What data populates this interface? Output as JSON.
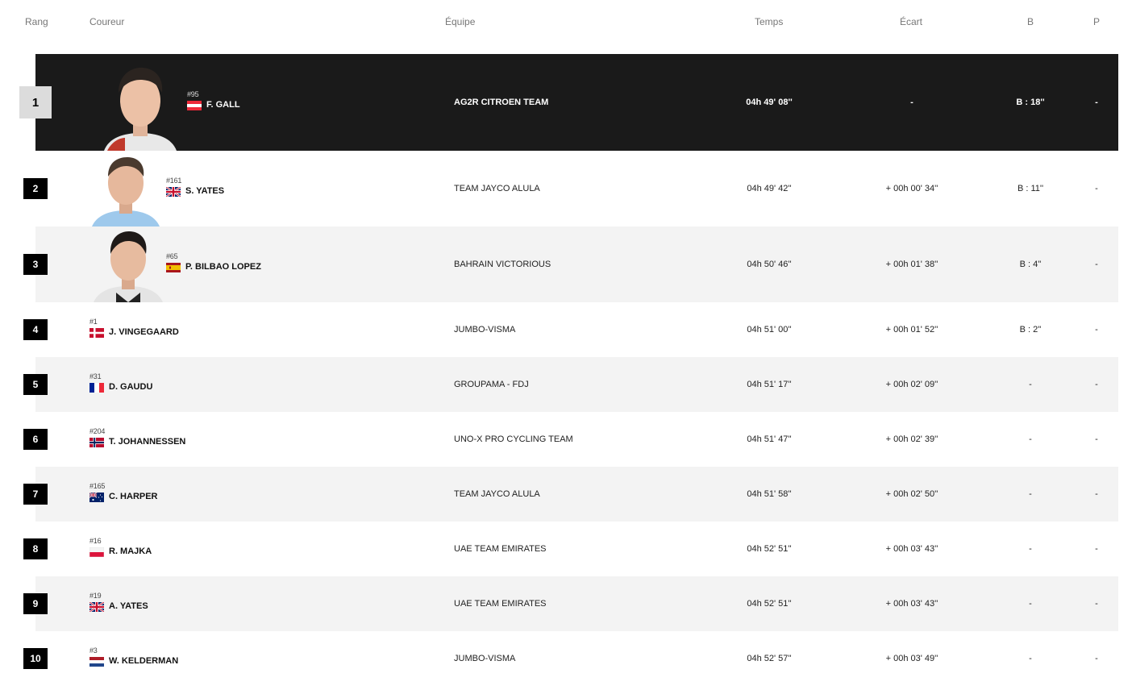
{
  "header": {
    "rang": "Rang",
    "coureur": "Coureur",
    "equipe": "Équipe",
    "temps": "Temps",
    "ecart": "Écart",
    "b": "B",
    "p": "P"
  },
  "rows": [
    {
      "rank": "1",
      "bib": "#95",
      "name": "F. GALL",
      "flag": "austria-flag-icon",
      "team": "AG2R CITROEN TEAM",
      "time": "04h 49' 08''",
      "gap": "-",
      "bonus": "B : 18''",
      "penalty": "-"
    },
    {
      "rank": "2",
      "bib": "#161",
      "name": "S. YATES",
      "flag": "uk-flag-icon",
      "team": "TEAM JAYCO ALULA",
      "time": "04h 49' 42''",
      "gap": "+ 00h 00' 34''",
      "bonus": "B : 11''",
      "penalty": "-"
    },
    {
      "rank": "3",
      "bib": "#65",
      "name": "P. BILBAO LOPEZ",
      "flag": "spain-flag-icon",
      "team": "BAHRAIN VICTORIOUS",
      "time": "04h 50' 46''",
      "gap": "+ 00h 01' 38''",
      "bonus": "B : 4''",
      "penalty": "-"
    },
    {
      "rank": "4",
      "bib": "#1",
      "name": "J. VINGEGAARD",
      "flag": "denmark-flag-icon",
      "team": "JUMBO-VISMA",
      "time": "04h 51' 00''",
      "gap": "+ 00h 01' 52''",
      "bonus": "B : 2''",
      "penalty": "-"
    },
    {
      "rank": "5",
      "bib": "#31",
      "name": "D. GAUDU",
      "flag": "france-flag-icon",
      "team": "GROUPAMA - FDJ",
      "time": "04h 51' 17''",
      "gap": "+ 00h 02' 09''",
      "bonus": "-",
      "penalty": "-"
    },
    {
      "rank": "6",
      "bib": "#204",
      "name": "T. JOHANNESSEN",
      "flag": "norway-flag-icon",
      "team": "UNO-X PRO CYCLING TEAM",
      "time": "04h 51' 47''",
      "gap": "+ 00h 02' 39''",
      "bonus": "-",
      "penalty": "-"
    },
    {
      "rank": "7",
      "bib": "#165",
      "name": "C. HARPER",
      "flag": "australia-flag-icon",
      "team": "TEAM JAYCO ALULA",
      "time": "04h 51' 58''",
      "gap": "+ 00h 02' 50''",
      "bonus": "-",
      "penalty": "-"
    },
    {
      "rank": "8",
      "bib": "#16",
      "name": "R. MAJKA",
      "flag": "poland-flag-icon",
      "team": "UAE TEAM EMIRATES",
      "time": "04h 52' 51''",
      "gap": "+ 00h 03' 43''",
      "bonus": "-",
      "penalty": "-"
    },
    {
      "rank": "9",
      "bib": "#19",
      "name": "A. YATES",
      "flag": "uk-flag-icon",
      "team": "UAE TEAM EMIRATES",
      "time": "04h 52' 51''",
      "gap": "+ 00h 03' 43''",
      "bonus": "-",
      "penalty": "-"
    },
    {
      "rank": "10",
      "bib": "#3",
      "name": "W. KELDERMAN",
      "flag": "netherlands-flag-icon",
      "team": "JUMBO-VISMA",
      "time": "04h 52' 57''",
      "gap": "+ 00h 03' 49''",
      "bonus": "-",
      "penalty": "-"
    }
  ],
  "colors": {
    "leader_bg": "#1a1a1a",
    "alt_row_bg": "#f3f3f3",
    "rank_badge": "#000000"
  }
}
